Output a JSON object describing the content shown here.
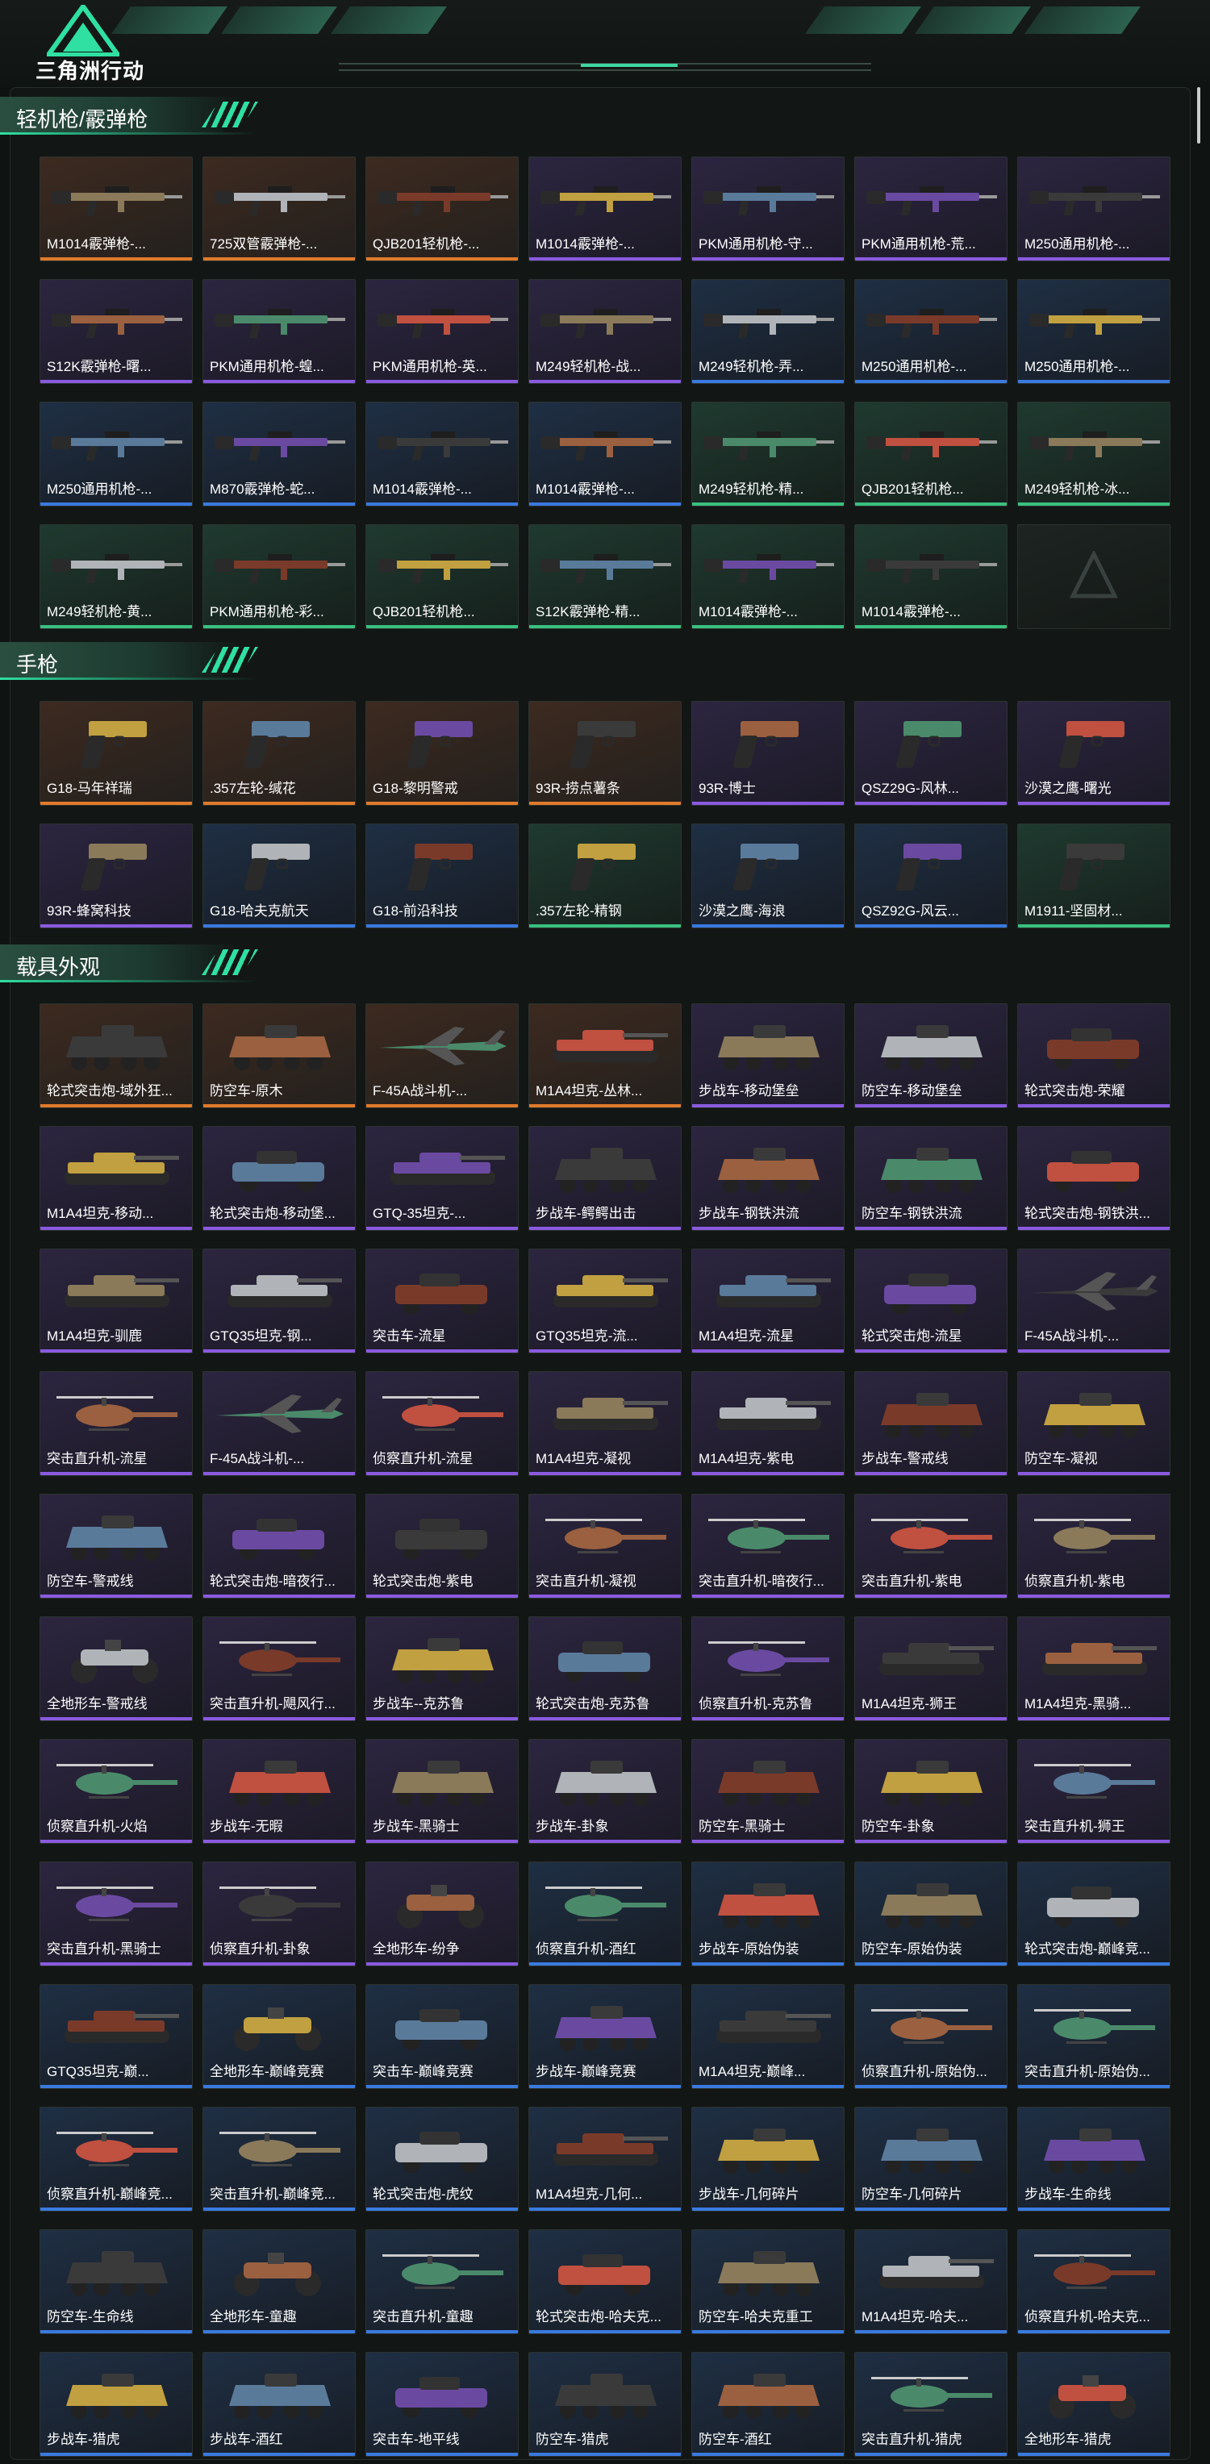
{
  "app": {
    "logo_text": "三角洲行动"
  },
  "palette": {
    "accent": "#2fe0a2",
    "rarity_orange": "#e07a2a",
    "rarity_purple": "#8a5ae0",
    "rarity_blue": "#3a7ae0",
    "rarity_green": "#3ac080"
  },
  "sections": [
    {
      "title": "轻机枪/霰弹枪",
      "kind": "gun",
      "items": [
        {
          "name": "M1014霰弹枪-...",
          "rarity": "orange"
        },
        {
          "name": "725双管霰弹枪-...",
          "rarity": "orange"
        },
        {
          "name": "QJB201轻机枪-...",
          "rarity": "orange"
        },
        {
          "name": "M1014霰弹枪-...",
          "rarity": "purple"
        },
        {
          "name": "PKM通用机枪-守...",
          "rarity": "purple"
        },
        {
          "name": "PKM通用机枪-荒...",
          "rarity": "purple"
        },
        {
          "name": "M250通用机枪-...",
          "rarity": "purple"
        },
        {
          "name": "S12K霰弹枪-曙...",
          "rarity": "purple"
        },
        {
          "name": "PKM通用机枪-蝗...",
          "rarity": "purple"
        },
        {
          "name": "PKM通用机枪-英...",
          "rarity": "purple"
        },
        {
          "name": "M249轻机枪-战...",
          "rarity": "purple"
        },
        {
          "name": "M249轻机枪-弄...",
          "rarity": "blue"
        },
        {
          "name": "M250通用机枪-...",
          "rarity": "blue"
        },
        {
          "name": "M250通用机枪-...",
          "rarity": "blue"
        },
        {
          "name": "M250通用机枪-...",
          "rarity": "blue"
        },
        {
          "name": "M870霰弹枪-蛇...",
          "rarity": "blue"
        },
        {
          "name": "M1014霰弹枪-...",
          "rarity": "blue"
        },
        {
          "name": "M1014霰弹枪-...",
          "rarity": "blue"
        },
        {
          "name": "M249轻机枪-精...",
          "rarity": "green"
        },
        {
          "name": "QJB201轻机枪...",
          "rarity": "green"
        },
        {
          "name": "M249轻机枪-冰...",
          "rarity": "green"
        },
        {
          "name": "M249轻机枪-黄...",
          "rarity": "green"
        },
        {
          "name": "PKM通用机枪-彩...",
          "rarity": "green"
        },
        {
          "name": "QJB201轻机枪...",
          "rarity": "green"
        },
        {
          "name": "S12K霰弹枪-精...",
          "rarity": "green"
        },
        {
          "name": "M1014霰弹枪-...",
          "rarity": "green"
        },
        {
          "name": "M1014霰弹枪-...",
          "rarity": "green"
        },
        {
          "name": "",
          "rarity": "empty"
        }
      ]
    },
    {
      "title": "手枪",
      "kind": "pistol",
      "items": [
        {
          "name": "G18-马年祥瑞",
          "rarity": "orange"
        },
        {
          "name": ".357左轮-缄花",
          "rarity": "orange"
        },
        {
          "name": "G18-黎明警戒",
          "rarity": "orange"
        },
        {
          "name": "93R-捞点薯条",
          "rarity": "orange"
        },
        {
          "name": "93R-博士",
          "rarity": "purple"
        },
        {
          "name": "QSZ29G-风林...",
          "rarity": "purple"
        },
        {
          "name": "沙漠之鹰-曙光",
          "rarity": "purple"
        },
        {
          "name": "93R-蜂窝科技",
          "rarity": "purple"
        },
        {
          "name": "G18-哈夫克航天",
          "rarity": "blue"
        },
        {
          "name": "G18-前沿科技",
          "rarity": "blue"
        },
        {
          "name": ".357左轮-精钢",
          "rarity": "green"
        },
        {
          "name": "沙漠之鹰-海浪",
          "rarity": "blue"
        },
        {
          "name": "QSZ92G-风云...",
          "rarity": "blue"
        },
        {
          "name": "M1911-坚固材...",
          "rarity": "green"
        }
      ]
    },
    {
      "title": "载具外观",
      "kind": "vehicle",
      "items": [
        {
          "name": "轮式突击炮-域外狂...",
          "rarity": "orange",
          "v": "apc"
        },
        {
          "name": "防空车-原木",
          "rarity": "orange",
          "v": "apc"
        },
        {
          "name": "F-45A战斗机-...",
          "rarity": "orange",
          "v": "jet"
        },
        {
          "name": "M1A4坦克-丛林...",
          "rarity": "orange",
          "v": "tank"
        },
        {
          "name": "步战车-移动堡垒",
          "rarity": "purple",
          "v": "apc"
        },
        {
          "name": "防空车-移动堡垒",
          "rarity": "purple",
          "v": "apc"
        },
        {
          "name": "轮式突击炮-荣耀",
          "rarity": "purple",
          "v": "car"
        },
        {
          "name": "M1A4坦克-移动...",
          "rarity": "purple",
          "v": "tank"
        },
        {
          "name": "轮式突击炮-移动堡...",
          "rarity": "purple",
          "v": "car"
        },
        {
          "name": "GTQ-35坦克-...",
          "rarity": "purple",
          "v": "tank"
        },
        {
          "name": "步战车-鳄鳄出击",
          "rarity": "purple",
          "v": "apc"
        },
        {
          "name": "步战车-钢铁洪流",
          "rarity": "purple",
          "v": "apc"
        },
        {
          "name": "防空车-钢铁洪流",
          "rarity": "purple",
          "v": "apc"
        },
        {
          "name": "轮式突击炮-钢铁洪...",
          "rarity": "purple",
          "v": "car"
        },
        {
          "name": "M1A4坦克-驯鹿",
          "rarity": "purple",
          "v": "tank"
        },
        {
          "name": "GTQ35坦克-钢...",
          "rarity": "purple",
          "v": "tank"
        },
        {
          "name": "突击车-流星",
          "rarity": "purple",
          "v": "car"
        },
        {
          "name": "GTQ35坦克-流...",
          "rarity": "purple",
          "v": "tank"
        },
        {
          "name": "M1A4坦克-流星",
          "rarity": "purple",
          "v": "tank"
        },
        {
          "name": "轮式突击炮-流星",
          "rarity": "purple",
          "v": "car"
        },
        {
          "name": "F-45A战斗机-...",
          "rarity": "purple",
          "v": "jet"
        },
        {
          "name": "突击直升机-流星",
          "rarity": "purple",
          "v": "heli"
        },
        {
          "name": "F-45A战斗机-...",
          "rarity": "purple",
          "v": "jet"
        },
        {
          "name": "侦察直升机-流星",
          "rarity": "purple",
          "v": "heli"
        },
        {
          "name": "M1A4坦克-凝视",
          "rarity": "purple",
          "v": "tank"
        },
        {
          "name": "M1A4坦克-紫电",
          "rarity": "purple",
          "v": "tank"
        },
        {
          "name": "步战车-警戒线",
          "rarity": "purple",
          "v": "apc"
        },
        {
          "name": "防空车-凝视",
          "rarity": "purple",
          "v": "apc"
        },
        {
          "name": "防空车-警戒线",
          "rarity": "purple",
          "v": "apc"
        },
        {
          "name": "轮式突击炮-暗夜行...",
          "rarity": "purple",
          "v": "car"
        },
        {
          "name": "轮式突击炮-紫电",
          "rarity": "purple",
          "v": "car"
        },
        {
          "name": "突击直升机-凝视",
          "rarity": "purple",
          "v": "heli"
        },
        {
          "name": "突击直升机-暗夜行...",
          "rarity": "purple",
          "v": "heli"
        },
        {
          "name": "突击直升机-紫电",
          "rarity": "purple",
          "v": "heli"
        },
        {
          "name": "侦察直升机-紫电",
          "rarity": "purple",
          "v": "heli"
        },
        {
          "name": "全地形车-警戒线",
          "rarity": "purple",
          "v": "atv"
        },
        {
          "name": "突击直升机-飓风行...",
          "rarity": "purple",
          "v": "heli"
        },
        {
          "name": "步战车--克苏鲁",
          "rarity": "purple",
          "v": "apc"
        },
        {
          "name": "轮式突击炮-克苏鲁",
          "rarity": "purple",
          "v": "car"
        },
        {
          "name": "侦察直升机-克苏鲁",
          "rarity": "purple",
          "v": "heli"
        },
        {
          "name": "M1A4坦克-狮王",
          "rarity": "purple",
          "v": "tank"
        },
        {
          "name": "M1A4坦克-黑骑...",
          "rarity": "purple",
          "v": "tank"
        },
        {
          "name": "侦察直升机-火焰",
          "rarity": "purple",
          "v": "heli"
        },
        {
          "name": "步战车-无暇",
          "rarity": "purple",
          "v": "apc"
        },
        {
          "name": "步战车-黑骑士",
          "rarity": "purple",
          "v": "apc"
        },
        {
          "name": "步战车-卦象",
          "rarity": "purple",
          "v": "apc"
        },
        {
          "name": "防空车-黑骑士",
          "rarity": "purple",
          "v": "apc"
        },
        {
          "name": "防空车-卦象",
          "rarity": "purple",
          "v": "apc"
        },
        {
          "name": "突击直升机-狮王",
          "rarity": "purple",
          "v": "heli"
        },
        {
          "name": "突击直升机-黑骑士",
          "rarity": "purple",
          "v": "heli"
        },
        {
          "name": "侦察直升机-卦象",
          "rarity": "purple",
          "v": "heli"
        },
        {
          "name": "全地形车-纷争",
          "rarity": "purple",
          "v": "atv"
        },
        {
          "name": "侦察直升机-酒红",
          "rarity": "blue",
          "v": "heli"
        },
        {
          "name": "步战车-原始伪装",
          "rarity": "blue",
          "v": "apc"
        },
        {
          "name": "防空车-原始伪装",
          "rarity": "blue",
          "v": "apc"
        },
        {
          "name": "轮式突击炮-巅峰竞...",
          "rarity": "blue",
          "v": "car"
        },
        {
          "name": "GTQ35坦克-巅...",
          "rarity": "blue",
          "v": "tank"
        },
        {
          "name": "全地形车-巅峰竞赛",
          "rarity": "blue",
          "v": "atv"
        },
        {
          "name": "突击车-巅峰竞赛",
          "rarity": "blue",
          "v": "car"
        },
        {
          "name": "步战车-巅峰竞赛",
          "rarity": "blue",
          "v": "apc"
        },
        {
          "name": "M1A4坦克-巅峰...",
          "rarity": "blue",
          "v": "tank"
        },
        {
          "name": "侦察直升机-原始伪...",
          "rarity": "blue",
          "v": "heli"
        },
        {
          "name": "突击直升机-原始伪...",
          "rarity": "blue",
          "v": "heli"
        },
        {
          "name": "侦察直升机-巅峰竞...",
          "rarity": "blue",
          "v": "heli"
        },
        {
          "name": "突击直升机-巅峰竞...",
          "rarity": "blue",
          "v": "heli"
        },
        {
          "name": "轮式突击炮-虎纹",
          "rarity": "blue",
          "v": "car"
        },
        {
          "name": "M1A4坦克-几何...",
          "rarity": "blue",
          "v": "tank"
        },
        {
          "name": "步战车-几何碎片",
          "rarity": "blue",
          "v": "apc"
        },
        {
          "name": "防空车-几何碎片",
          "rarity": "blue",
          "v": "apc"
        },
        {
          "name": "步战车-生命线",
          "rarity": "blue",
          "v": "apc"
        },
        {
          "name": "防空车-生命线",
          "rarity": "blue",
          "v": "apc"
        },
        {
          "name": "全地形车-童趣",
          "rarity": "blue",
          "v": "atv"
        },
        {
          "name": "突击直升机-童趣",
          "rarity": "blue",
          "v": "heli"
        },
        {
          "name": "轮式突击炮-哈夫克...",
          "rarity": "blue",
          "v": "car"
        },
        {
          "name": "防空车-哈夫克重工",
          "rarity": "blue",
          "v": "apc"
        },
        {
          "name": "M1A4坦克-哈夫...",
          "rarity": "blue",
          "v": "tank"
        },
        {
          "name": "侦察直升机-哈夫克...",
          "rarity": "blue",
          "v": "heli"
        },
        {
          "name": "步战车-猎虎",
          "rarity": "blue",
          "v": "apc"
        },
        {
          "name": "步战车-酒红",
          "rarity": "blue",
          "v": "apc"
        },
        {
          "name": "突击车-地平线",
          "rarity": "blue",
          "v": "car"
        },
        {
          "name": "防空车-猎虎",
          "rarity": "blue",
          "v": "apc"
        },
        {
          "name": "防空车-酒红",
          "rarity": "blue",
          "v": "apc"
        },
        {
          "name": "突击直升机-猎虎",
          "rarity": "blue",
          "v": "heli"
        },
        {
          "name": "全地形车-猎虎",
          "rarity": "blue",
          "v": "atv"
        }
      ]
    }
  ]
}
